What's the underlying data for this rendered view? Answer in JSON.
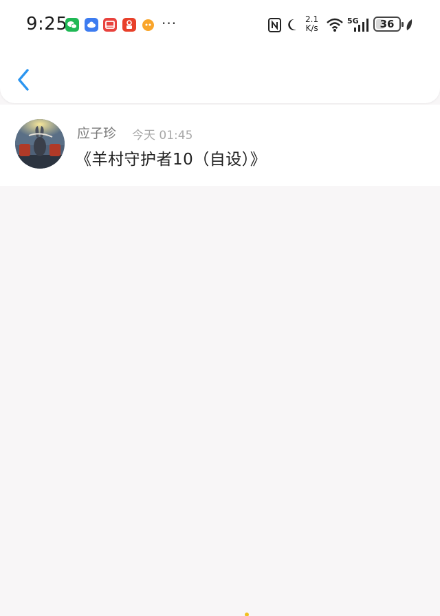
{
  "status_bar": {
    "time": "9:25",
    "more": "···",
    "network_speed_value": "2.1",
    "network_speed_unit": "K/s",
    "network_type": "5G",
    "battery_level": "36"
  },
  "nav": {
    "back_icon": "chevron-left-icon"
  },
  "post": {
    "author": "应子珍",
    "timestamp": "今天 01:45",
    "title": "《羊村守护者10（自设）》"
  },
  "colors": {
    "accent": "#2b95f0",
    "background": "#f8f6f7",
    "card": "#ffffff"
  }
}
